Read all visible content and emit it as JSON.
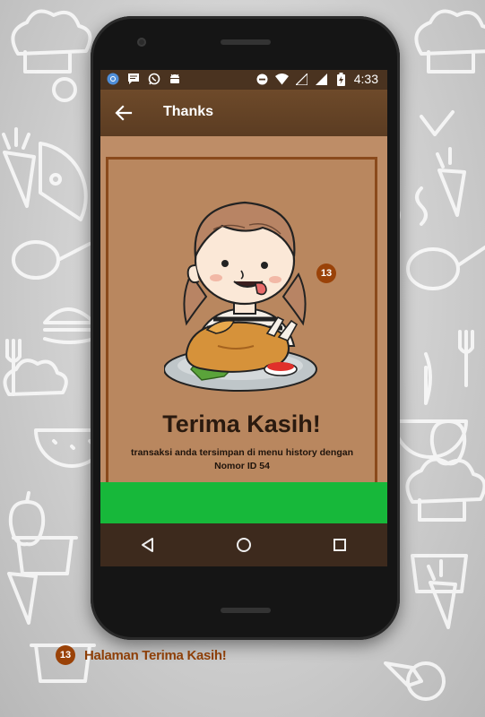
{
  "status_bar": {
    "time": "4:33",
    "icons": [
      "chrome-icon",
      "chat-icon",
      "whatsapp-icon",
      "android-icon",
      "do-not-disturb-icon",
      "wifi-icon",
      "signal-icon",
      "signal-icon",
      "battery-charging-icon"
    ]
  },
  "app_bar": {
    "title": "Thanks",
    "back_icon": "arrow-back-icon"
  },
  "thanks": {
    "title": "Terima Kasih!",
    "message": "transaksi anda tersimpan di menu history dengan Nomor ID 54",
    "badge": "13"
  },
  "nav": {
    "icons": [
      "back-triangle-icon",
      "home-circle-icon",
      "recents-square-icon"
    ]
  },
  "caption": {
    "number": "13",
    "text": "Halaman Terima Kasih!"
  },
  "colors": {
    "status_bar": "#4a3320",
    "app_bar": "#5b3c22",
    "content": "#be8d67",
    "card_border": "#8a4a1c",
    "action_button": "#17b83a",
    "navbar": "#3d2a1d",
    "badge": "#9a4208",
    "caption_text": "#8d3f08"
  }
}
